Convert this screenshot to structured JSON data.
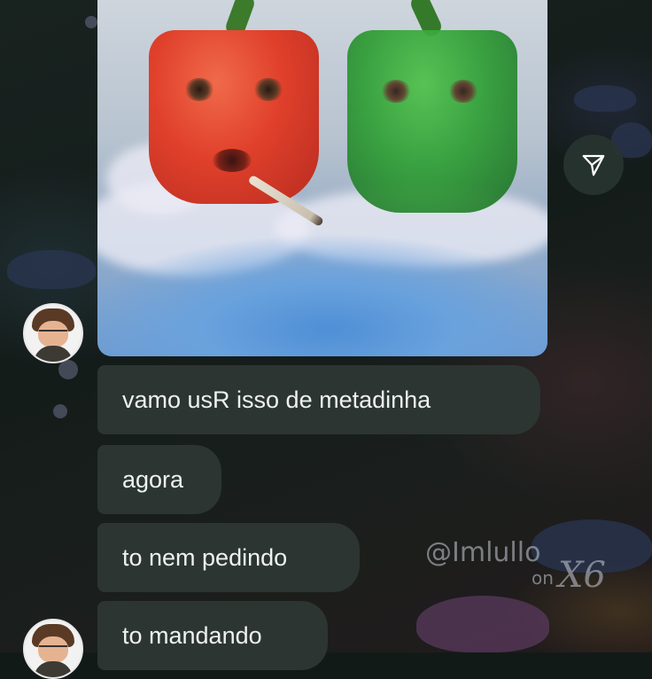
{
  "chat": {
    "image_alt": "Two bell pepper faces (red and green) in a cloud of smoke, the red one holding a joint",
    "messages": [
      "vamo usR isso de metadinha",
      "agora",
      "to nem pedindo",
      "to mandando"
    ]
  },
  "watermark": {
    "handle": "@Imlullo",
    "suffix_on": "on",
    "suffix_mark": "X6"
  },
  "icons": {
    "share": "share-icon",
    "avatar": "avatar"
  },
  "colors": {
    "bubble": "#2c3532",
    "text": "#eef1ef",
    "background": "#121a17"
  }
}
